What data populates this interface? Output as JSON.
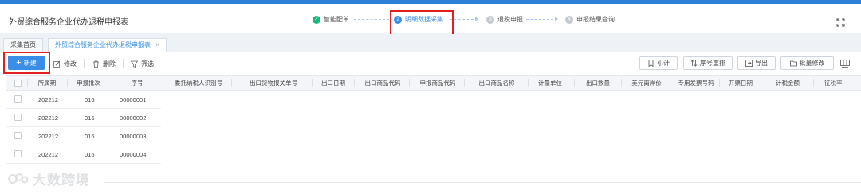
{
  "header": {
    "title": "外贸综合服务企业代办退税申报表",
    "steps": [
      {
        "num": "✓",
        "label": "智能配单",
        "state": "done"
      },
      {
        "num": "2",
        "label": "明细数据采集",
        "state": "active"
      },
      {
        "num": "3",
        "label": "退税申报",
        "state": "todo"
      },
      {
        "num": "4",
        "label": "申报结果查询",
        "state": "todo"
      }
    ]
  },
  "tabs": [
    {
      "label": "采集首页",
      "active": false
    },
    {
      "label": "外贸综合服务企业代办退税申报表",
      "active": true,
      "close": "×"
    }
  ],
  "toolbar": {
    "new_label": "新建",
    "edit_label": "修改",
    "delete_label": "删除",
    "filter_label": "筛选",
    "subtotal_label": "小计",
    "reorder_label": "序号重排",
    "export_label": "导出",
    "batch_edit_label": "批量修改"
  },
  "table": {
    "columns": [
      "所属期",
      "申报批次",
      "序号",
      "委托纳税人识别号",
      "出口货物报关单号",
      "出口日期",
      "出口商品代码",
      "申报商品代码",
      "出口商品名称",
      "计量单位",
      "出口数量",
      "美元离岸价",
      "专用发票号码",
      "开票日期",
      "计税金额",
      "征税率"
    ],
    "rows": [
      [
        "202212",
        "016",
        "00000001"
      ],
      [
        "202212",
        "016",
        "00000002"
      ],
      [
        "202212",
        "016",
        "00000003"
      ],
      [
        "202212",
        "016",
        "00000004"
      ]
    ]
  },
  "watermark": {
    "text": "大数跨境"
  },
  "colors": {
    "accent": "#3a8ee6",
    "highlight": "#e02020",
    "done": "#19b67e"
  }
}
